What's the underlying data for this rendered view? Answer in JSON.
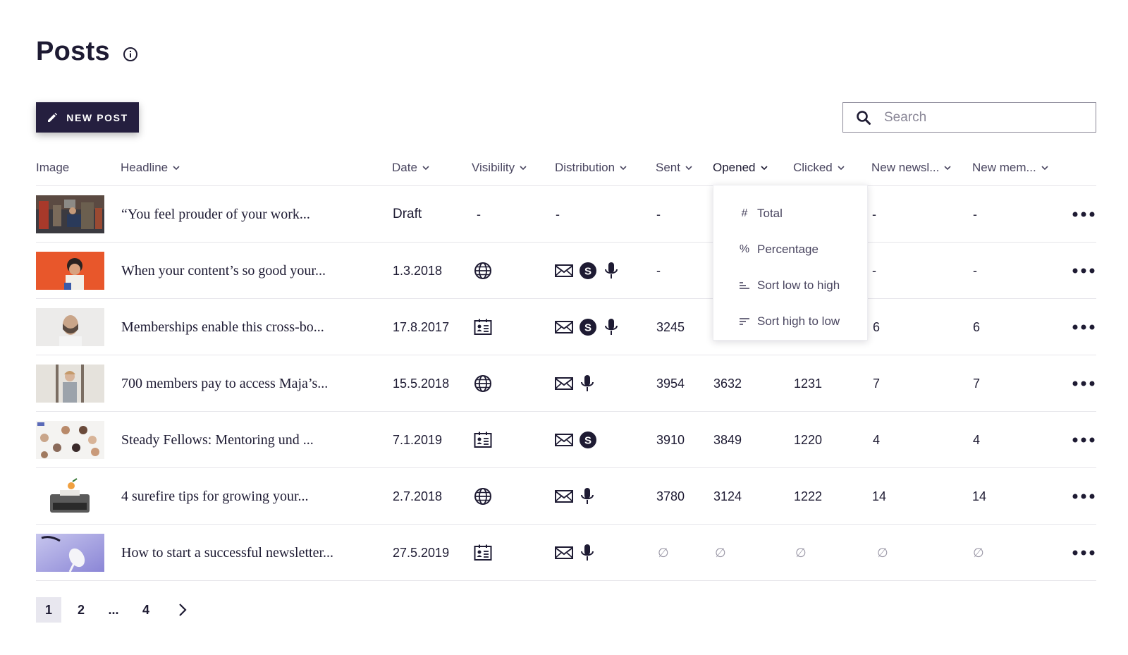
{
  "page": {
    "title": "Posts"
  },
  "toolbar": {
    "new_post_label": "NEW POST",
    "search_placeholder": "Search"
  },
  "columns": {
    "image": "Image",
    "headline": "Headline",
    "date": "Date",
    "visibility": "Visibility",
    "distribution": "Distribution",
    "sent": "Sent",
    "opened": "Opened",
    "clicked": "Clicked",
    "new_newsletter": "New newsl...",
    "new_members": "New mem..."
  },
  "opened_menu": {
    "items": [
      {
        "symbol": "#",
        "label": "Total",
        "icon": "hash-icon"
      },
      {
        "symbol": "%",
        "label": "Percentage",
        "icon": "percent-icon"
      },
      {
        "symbol": "",
        "label": "Sort low to high",
        "icon": "sort-ascending-icon"
      },
      {
        "symbol": "",
        "label": "Sort high to low",
        "icon": "sort-descending-icon"
      }
    ]
  },
  "rows": [
    {
      "headline": "“You feel prouder of your work...",
      "date": "Draft",
      "visibility": "-",
      "visibility_icon": "",
      "distribution": [
        "-"
      ],
      "sent": "-",
      "opened": "",
      "clicked": "",
      "new_newsletter": "-",
      "new_members": "-"
    },
    {
      "headline": "When your content’s so good your...",
      "date": "1.3.2018",
      "visibility": "",
      "visibility_icon": "globe-icon",
      "distribution": [
        "mail-icon",
        "steady-icon",
        "microphone-icon"
      ],
      "sent": "-",
      "opened": "",
      "clicked": "",
      "new_newsletter": "-",
      "new_members": "-"
    },
    {
      "headline": "Memberships enable this cross-bo...",
      "date": "17.8.2017",
      "visibility": "",
      "visibility_icon": "member-card-icon",
      "distribution": [
        "mail-icon",
        "steady-icon",
        "microphone-icon"
      ],
      "sent": "3245",
      "opened": "",
      "clicked": "",
      "new_newsletter": "6",
      "new_members": "6"
    },
    {
      "headline": "700 members pay to access Maja’s...",
      "date": "15.5.2018",
      "visibility": "",
      "visibility_icon": "globe-icon",
      "distribution": [
        "mail-icon",
        "microphone-icon"
      ],
      "sent": "3954",
      "opened": "3632",
      "clicked": "1231",
      "new_newsletter": "7",
      "new_members": "7"
    },
    {
      "headline": "Steady Fellows: Mentoring und ...",
      "date": "7.1.2019",
      "visibility": "",
      "visibility_icon": "member-card-icon",
      "distribution": [
        "mail-icon",
        "steady-icon"
      ],
      "sent": "3910",
      "opened": "3849",
      "clicked": "1220",
      "new_newsletter": "4",
      "new_members": "4"
    },
    {
      "headline": "4 surefire tips for growing your...",
      "date": "2.7.2018",
      "visibility": "",
      "visibility_icon": "globe-icon",
      "distribution": [
        "mail-icon",
        "microphone-icon"
      ],
      "sent": "3780",
      "opened": "3124",
      "clicked": "1222",
      "new_newsletter": "14",
      "new_members": "14"
    },
    {
      "headline": "How to start a successful newsletter...",
      "date": "27.5.2019",
      "visibility": "",
      "visibility_icon": "member-card-icon",
      "distribution": [
        "mail-icon",
        "microphone-icon"
      ],
      "sent": "∅",
      "opened": "∅",
      "clicked": "∅",
      "new_newsletter": "∅",
      "new_members": "∅"
    }
  ],
  "pagination": {
    "pages": [
      "1",
      "2",
      "...",
      "4"
    ],
    "current": "1"
  },
  "colors": {
    "primary": "#251f3f",
    "text": "#1e1b33",
    "muted": "#4a4660",
    "border": "#e6e5ea",
    "thumb_orange": "#e8572b"
  }
}
